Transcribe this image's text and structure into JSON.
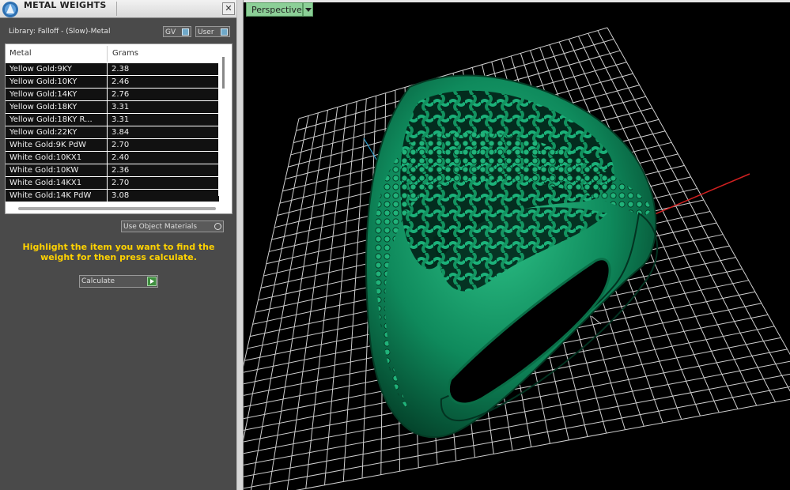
{
  "panel": {
    "title": "METAL WEIGHTS",
    "close_label": "✕",
    "library_label": "Library: Falloff - (Slow)-Metal",
    "toggle_gv": "GV",
    "toggle_user": "User"
  },
  "table": {
    "headers": [
      "Metal",
      "Grams"
    ],
    "rows": [
      {
        "metal": "Yellow Gold:9KY",
        "grams": "2.38"
      },
      {
        "metal": "Yellow Gold:10KY",
        "grams": "2.46"
      },
      {
        "metal": "Yellow Gold:14KY",
        "grams": "2.76"
      },
      {
        "metal": "Yellow Gold:18KY",
        "grams": "3.31"
      },
      {
        "metal": "Yellow Gold:18KY R...",
        "grams": "3.31"
      },
      {
        "metal": "Yellow Gold:22KY",
        "grams": "3.84"
      },
      {
        "metal": "White Gold:9K PdW",
        "grams": "2.70"
      },
      {
        "metal": "White Gold:10KX1",
        "grams": "2.40"
      },
      {
        "metal": "White Gold:10KW",
        "grams": "2.36"
      },
      {
        "metal": "White Gold:14KX1",
        "grams": "2.70"
      },
      {
        "metal": "White Gold:14K PdW",
        "grams": "3.08"
      }
    ]
  },
  "options": {
    "use_object_materials": "Use Object Materials"
  },
  "hint": "Highlight the item you want to find the weight for then press calculate.",
  "calculate_label": "Calculate",
  "viewport": {
    "view_name": "Perspective"
  },
  "colors": {
    "panel_bg": "#4a4a4a",
    "hint_text": "#ffd200",
    "viewport_tab": "#8ccf97",
    "model": "#0f8a5c",
    "grid": "#cfcfcf",
    "x_axis": "#d02020"
  },
  "icons": [
    "rhino-app-icon",
    "close-icon",
    "toggle-knob-icon",
    "radio-knob-icon",
    "play-arrow-icon",
    "dropdown-arrow-icon"
  ]
}
